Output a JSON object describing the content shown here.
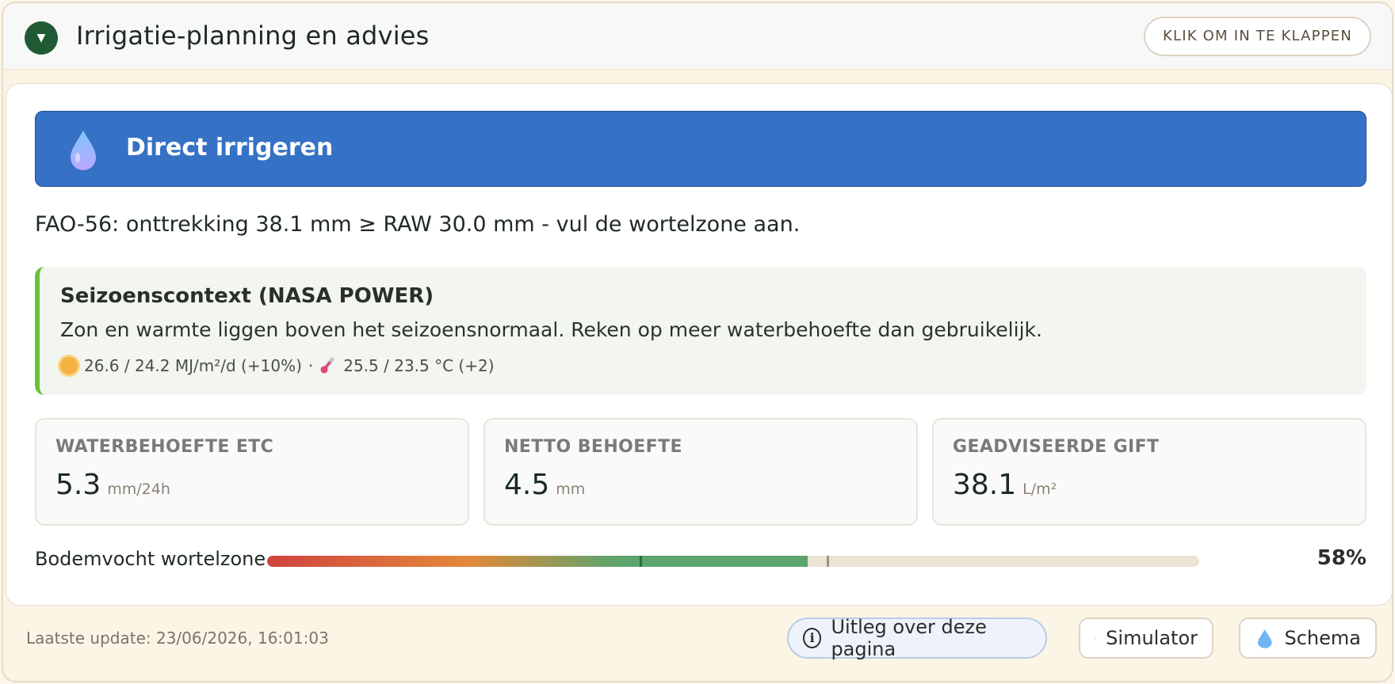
{
  "header": {
    "title": "Irrigatie-planning en advies",
    "collapse_label": "KLIK OM IN TE KLAPPEN",
    "toggle_glyph": "▼"
  },
  "advice": {
    "banner_title": "Direct irrigeren",
    "banner_color": "#3571c5",
    "fao_text": "FAO-56: onttrekking 38.1 mm ≥ RAW 30.0 mm - vul de wortelzone aan."
  },
  "season": {
    "title": "Seizoenscontext (NASA POWER)",
    "text": "Zon en warmte liggen boven het seizoensnormaal. Reken op meer waterbehoefte dan gebruikelijk.",
    "radiation": "26.6 / 24.2 MJ/m²/d (+10%)",
    "separator": "·",
    "temperature": "25.5 / 23.5 °C (+2)",
    "accent_color": "#67c23a"
  },
  "stats": [
    {
      "label": "WATERBEHOEFTE ETC",
      "value": "5.3",
      "unit": "mm/24h"
    },
    {
      "label": "NETTO BEHOEFTE",
      "value": "4.5",
      "unit": "mm"
    },
    {
      "label": "GEADVISEERDE GIFT",
      "value": "38.1",
      "unit": "L/m²"
    }
  ],
  "moisture": {
    "label": "Bodemvocht wortelzone",
    "value_text": "58%",
    "fill_fraction": 0.58,
    "marker_fractions": [
      0.4,
      0.6
    ]
  },
  "footer": {
    "last_update": "Laatste update: 23/06/2026, 16:01:03",
    "info_label": "Uitleg over deze pagina",
    "simulator_label": "Simulator",
    "schema_label": "Schema"
  }
}
